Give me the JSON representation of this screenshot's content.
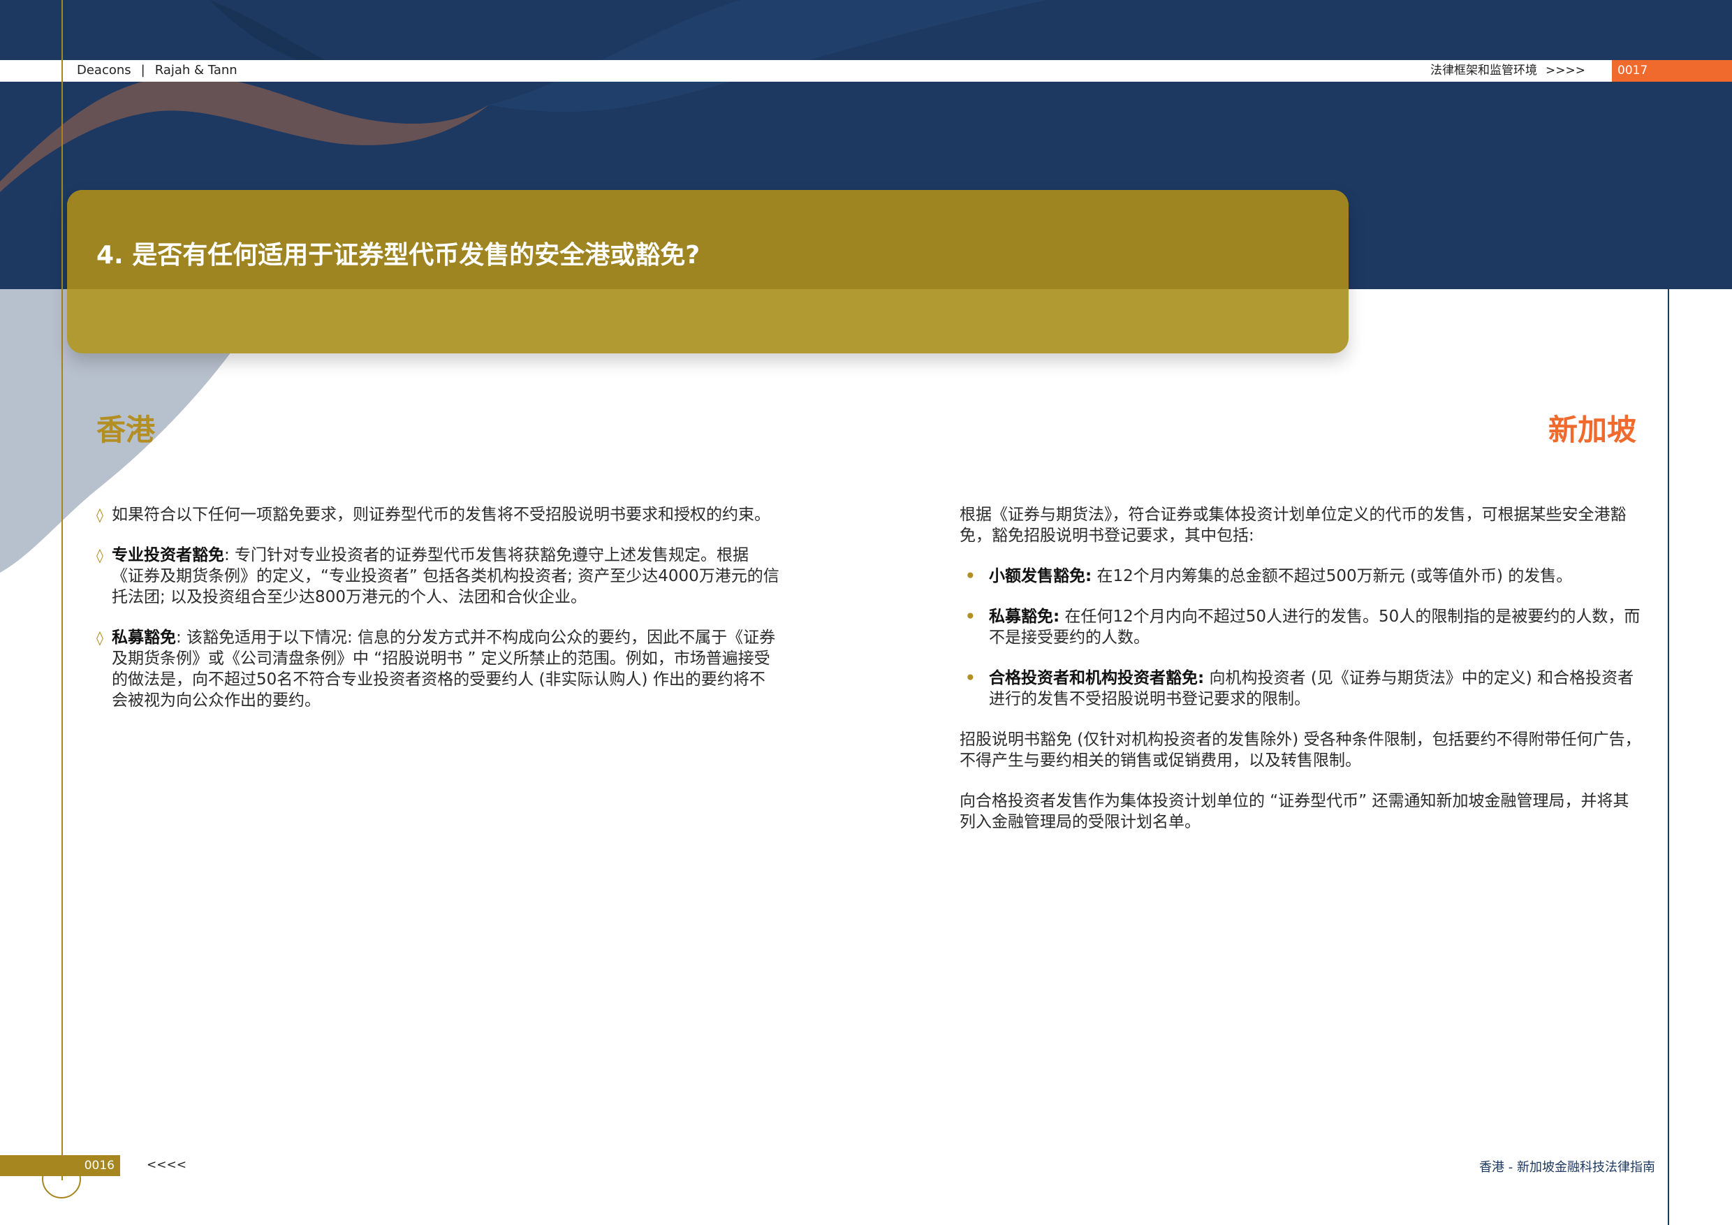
{
  "header": {
    "brand_left": "Deacons",
    "separator": "|",
    "brand_right": "Rajah & Tann",
    "section": "法律框架和监管环境",
    "section_arrows": ">>>>",
    "page_right": "0017"
  },
  "question": {
    "title": "4. 是否有任何适用于证券型代币发售的安全港或豁免?"
  },
  "hong_kong": {
    "heading": "香港",
    "bullet_symbol": "◊",
    "items": [
      {
        "bold": "",
        "text": "如果符合以下任何一项豁免要求，则证券型代币的发售将不受招股说明书要求和授权的约束。"
      },
      {
        "bold": "专业投资者豁免",
        "text": ": 专门针对专业投资者的证券型代币发售将获豁免遵守上述发售规定。根据《证券及期货条例》的定义，“专业投资者” 包括各类机构投资者; 资产至少达4000万港元的信托法团; 以及投资组合至少达800万港元的个人、法团和合伙企业。"
      },
      {
        "bold": "私募豁免",
        "text": ": 该豁免适用于以下情况: 信息的分发方式并不构成向公众的要约，因此不属于《证券及期货条例》或《公司清盘条例》中 “招股说明书 ” 定义所禁止的范围。例如，市场普遍接受的做法是，向不超过50名不符合专业投资者资格的受要约人 (非实际认购人) 作出的要约将不会被视为向公众作出的要约。"
      }
    ]
  },
  "singapore": {
    "heading": "新加坡",
    "intro": "根据《证券与期货法》，符合证券或集体投资计划单位定义的代币的发售，可根据某些安全港豁免，豁免招股说明书登记要求，其中包括:",
    "bullet_symbol": "•",
    "items": [
      {
        "bold": "小额发售豁免:",
        "text": " 在12个月内筹集的总金额不超过500万新元 (或等值外币) 的发售。"
      },
      {
        "bold": "私募豁免:",
        "text": " 在任何12个月内向不超过50人进行的发售。50人的限制指的是被要约的人数，而不是接受要约的人数。"
      },
      {
        "bold": "合格投资者和机构投资者豁免:",
        "text": " 向机构投资者 (见《证券与期货法》中的定义) 和合格投资者进行的发售不受招股说明书登记要求的限制。"
      }
    ],
    "para2": "招股说明书豁免 (仅针对机构投资者的发售除外) 受各种条件限制，包括要约不得附带任何广告，不得产生与要约相关的销售或促销费用，以及转售限制。",
    "para3": "向合格投资者发售作为集体投资计划单位的 “证券型代币” 还需通知新加坡金融管理局，并将其列入金融管理局的受限计划名单。"
  },
  "footer": {
    "page_left": "0016",
    "arrows": "<<<<",
    "guide_title": "香港 - 新加坡金融科技法律指南"
  },
  "colors": {
    "navy": "#1d3961",
    "gold": "#a6861f",
    "question_box": "#b29a33",
    "orange": "#ef6a2c"
  }
}
